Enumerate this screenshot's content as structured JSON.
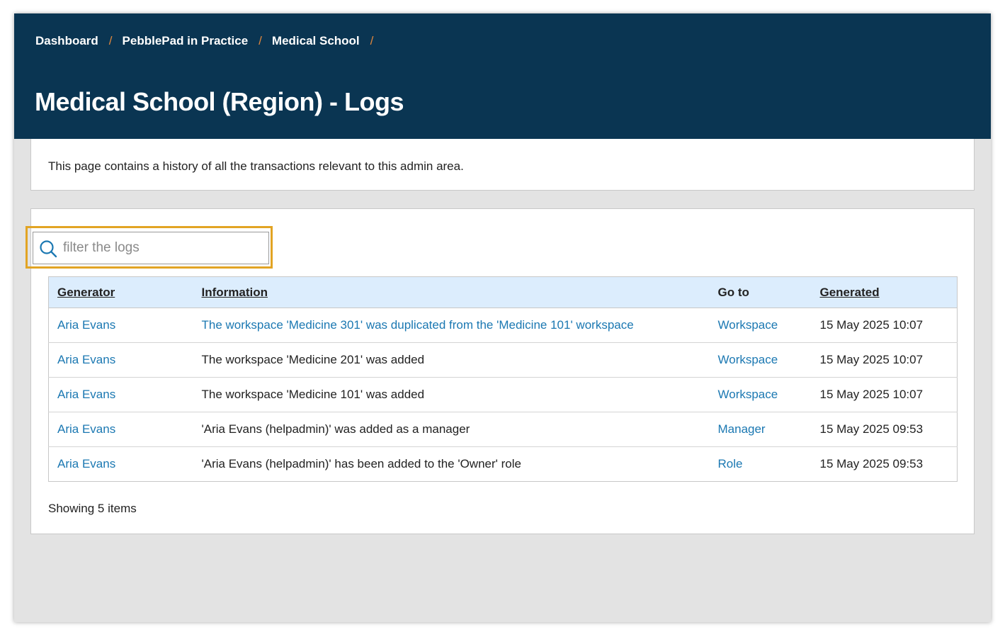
{
  "breadcrumb": [
    {
      "label": "Dashboard"
    },
    {
      "label": "PebblePad in Practice"
    },
    {
      "label": "Medical School"
    }
  ],
  "breadcrumb_separator": "/",
  "page_title": "Medical School (Region) - Logs",
  "intro_text": "This page contains a history of all the transactions relevant to this admin area.",
  "search": {
    "placeholder": "filter the logs",
    "value": "",
    "icon": "search-icon"
  },
  "table": {
    "headers": {
      "generator": "Generator",
      "information": "Information",
      "goto": "Go to",
      "generated": "Generated"
    },
    "rows": [
      {
        "generator": "Aria Evans",
        "information": "The workspace 'Medicine 301' was duplicated from the 'Medicine 101' workspace",
        "information_is_link": true,
        "goto": "Workspace",
        "generated": "15 May 2025 10:07"
      },
      {
        "generator": "Aria Evans",
        "information": "The workspace 'Medicine 201' was added",
        "information_is_link": false,
        "goto": "Workspace",
        "generated": "15 May 2025 10:07"
      },
      {
        "generator": "Aria Evans",
        "information": "The workspace 'Medicine 101' was added",
        "information_is_link": false,
        "goto": "Workspace",
        "generated": "15 May 2025 10:07"
      },
      {
        "generator": "Aria Evans",
        "information": "'Aria Evans (helpadmin)' was added as a manager",
        "information_is_link": false,
        "goto": "Manager",
        "generated": "15 May 2025 09:53"
      },
      {
        "generator": "Aria Evans",
        "information": "'Aria Evans (helpadmin)' has been added to the 'Owner' role",
        "information_is_link": false,
        "goto": "Role",
        "generated": "15 May 2025 09:53"
      }
    ]
  },
  "footer": {
    "count_text": "Showing 5 items"
  },
  "colors": {
    "header_bg": "#0a3552",
    "separator": "#e2873c",
    "link": "#1b78b2",
    "table_header_bg": "#dcedfd",
    "highlight": "#e2a424"
  }
}
